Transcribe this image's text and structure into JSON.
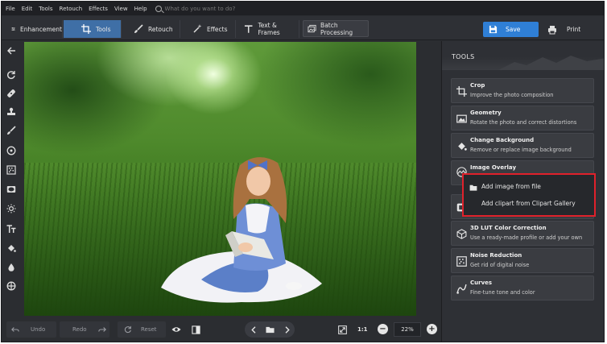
{
  "menu": [
    "File",
    "Edit",
    "Tools",
    "Retouch",
    "Effects",
    "View",
    "Help"
  ],
  "search": {
    "placeholder": "What do you want to do?"
  },
  "toolbar": {
    "tabs": [
      {
        "label": "Enhancement",
        "icon": "sliders-icon"
      },
      {
        "label": "Tools",
        "icon": "crop-icon",
        "active": true
      },
      {
        "label": "Retouch",
        "icon": "brush-icon"
      },
      {
        "label": "Effects",
        "icon": "magic-wand-icon"
      },
      {
        "label": "Text & Frames",
        "icon": "text-icon"
      }
    ],
    "batch_label": "Batch Processing",
    "save_label": "Save",
    "print_label": "Print"
  },
  "panel": {
    "title": "TOOLS",
    "items": [
      {
        "title": "Crop",
        "desc": "Improve the photo composition",
        "icon": "crop-icon"
      },
      {
        "title": "Geometry",
        "desc": "Rotate the photo and correct distortions",
        "icon": "geometry-icon"
      },
      {
        "title": "Change Background",
        "desc": "Remove or replace image background",
        "icon": "paint-bucket-icon"
      },
      {
        "title": "Image Overlay",
        "desc": "",
        "icon": "mountain-icon"
      },
      {
        "title": "",
        "desc": "",
        "icon": "frame-icon"
      },
      {
        "title": "3D LUT Color Correction",
        "desc": "Use a ready-made profile or add your own",
        "icon": "cube-icon"
      },
      {
        "title": "Noise Reduction",
        "desc": "Get rid of digital noise",
        "icon": "noise-icon"
      },
      {
        "title": "Curves",
        "desc": "Fine-tune tone and color",
        "icon": "curve-icon"
      }
    ]
  },
  "dropdown": {
    "items": [
      "Add image from file",
      "Add clipart from Clipart Gallery"
    ],
    "highlight_color": "#e0212b"
  },
  "bottombar": {
    "undo_label": "Undo",
    "redo_label": "Redo",
    "reset_label": "Reset",
    "ratio_label": "1:1",
    "zoom_value": "22%"
  },
  "colors": {
    "accent": "#3f6fa6",
    "save": "#2f7fd6",
    "bg": "#2b2d31"
  }
}
